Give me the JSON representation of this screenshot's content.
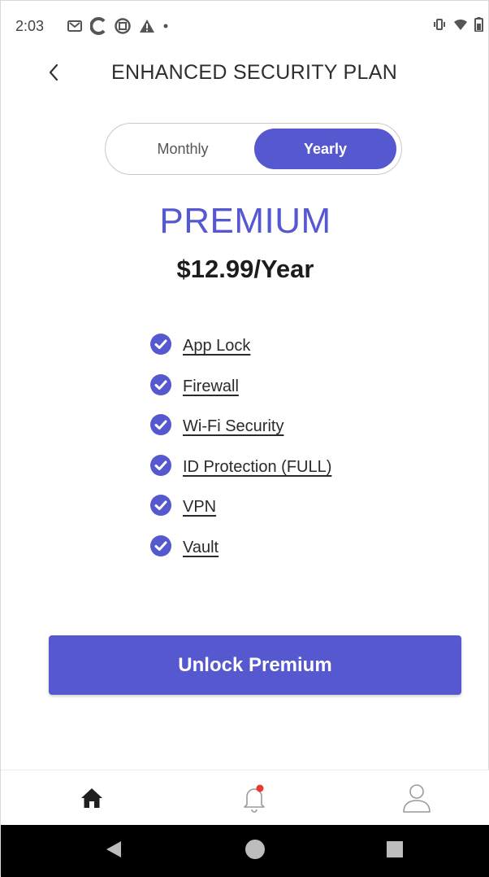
{
  "status_bar": {
    "time": "2:03",
    "left_icons": [
      "gmail-icon",
      "c-app-icon",
      "screenshot-icon",
      "warning-icon",
      "dot-icon"
    ],
    "right_icons": [
      "vibrate-icon",
      "wifi-icon",
      "battery-icon"
    ]
  },
  "header": {
    "title": "ENHANCED SECURITY PLAN",
    "back_icon": "chevron-left-icon"
  },
  "billing_toggle": {
    "monthly_label": "Monthly",
    "yearly_label": "Yearly",
    "selected": "Yearly"
  },
  "plan": {
    "name": "PREMIUM",
    "price": "$12.99/Year"
  },
  "features": [
    {
      "label": "App Lock"
    },
    {
      "label": "Firewall"
    },
    {
      "label": "Wi-Fi Security"
    },
    {
      "label": "ID Protection (FULL)"
    },
    {
      "label": "VPN"
    },
    {
      "label": "Vault"
    }
  ],
  "cta": {
    "label": "Unlock Premium"
  },
  "bottom_nav": {
    "items": [
      "home-icon",
      "bell-icon",
      "profile-icon"
    ],
    "notification_dot": true
  },
  "colors": {
    "accent": "#5558cf",
    "notification": "#e53935"
  }
}
